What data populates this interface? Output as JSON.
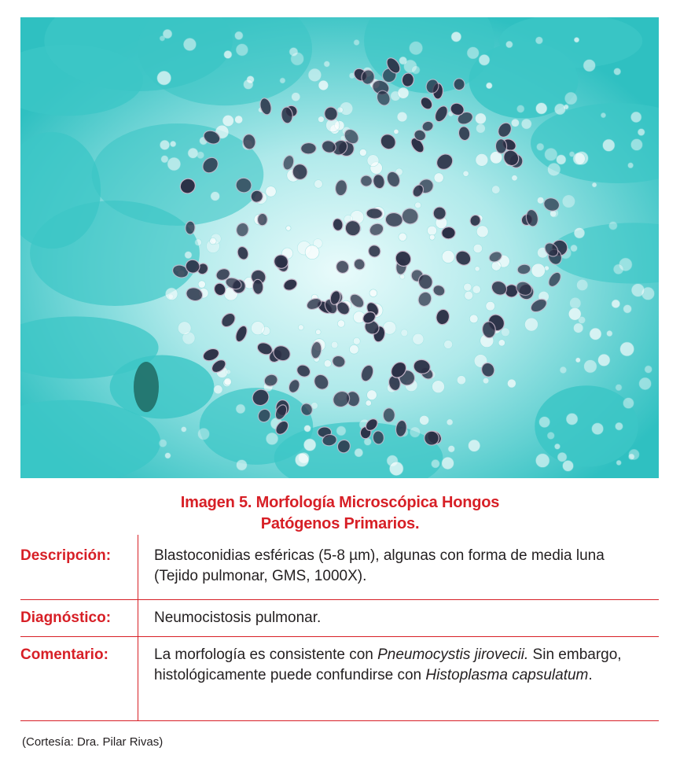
{
  "figure": {
    "caption_line1": "Imagen 5. Morfología Microscópica Hongos",
    "caption_line2": "Patógenos Primarios."
  },
  "table": {
    "rows": [
      {
        "label": "Descripción:",
        "text_line1": "Blastoconidias esféricas (5-8 µm), algunas con forma de media luna",
        "text_line2": "(Tejido pulmonar, GMS, 1000X)."
      },
      {
        "label": "Diagnóstico:",
        "text": "Neumocistosis pulmonar."
      },
      {
        "label": "Comentario:",
        "text_a": "La morfología es consistente con ",
        "text_italic_1": "Pneumocystis jirovecii.",
        "text_b": " Sin embargo, histológicamente puede confundirse con ",
        "text_italic_2": "Histoplasma capsulatum",
        "text_c": "."
      }
    ]
  },
  "credit": "(Cortesía: Dra. Pilar Rivas)",
  "colors": {
    "accent_red": "#d71f26",
    "stain_teal": "#3cc6c6",
    "organism_dark": "#2b3046"
  }
}
